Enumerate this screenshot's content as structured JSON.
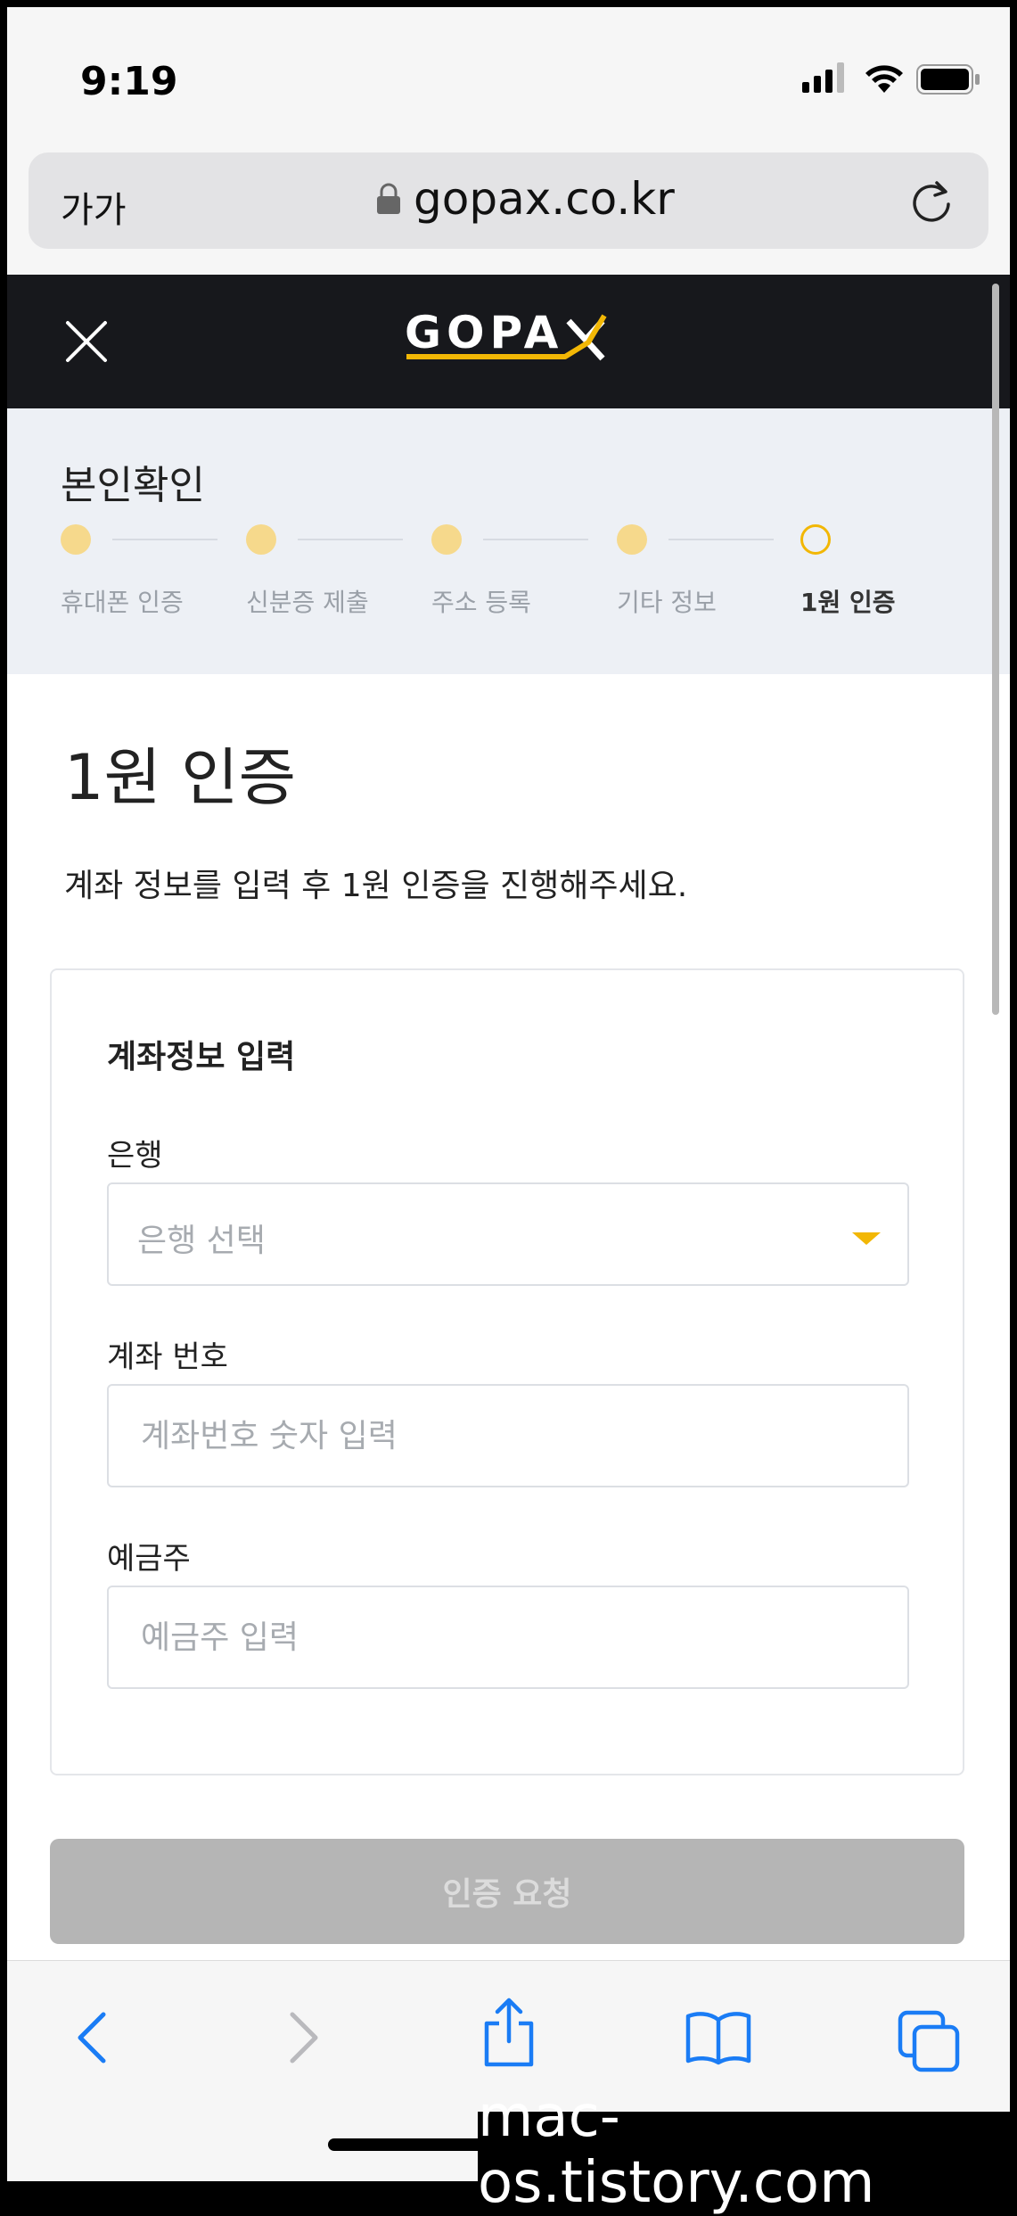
{
  "status": {
    "time": "9:19"
  },
  "browser": {
    "text_size": "가가",
    "url": "gopax.co.kr"
  },
  "site": {
    "logo": "GOPAX"
  },
  "stepper": {
    "title": "본인확인",
    "steps": [
      {
        "label": "휴대폰 인증",
        "state": "done"
      },
      {
        "label": "신분증 제출",
        "state": "done"
      },
      {
        "label": "주소 등록",
        "state": "done"
      },
      {
        "label": "기타 정보",
        "state": "done"
      },
      {
        "label": "1원 인증",
        "state": "current"
      }
    ]
  },
  "main": {
    "title": "1원 인증",
    "description": "계좌 정보를 입력 후 1원 인증을 진행해주세요.",
    "card_title": "계좌정보 입력",
    "bank": {
      "label": "은행",
      "placeholder": "은행 선택"
    },
    "account": {
      "label": "계좌 번호",
      "placeholder": "계좌번호 숫자 입력"
    },
    "holder": {
      "label": "예금주",
      "placeholder": "예금주 입력"
    },
    "submit_label": "인증 요청"
  },
  "watermark": "mac-os.tistory.com",
  "colors": {
    "accent": "#f2b705",
    "step_done": "#f6d98c",
    "header_bg": "#17181c",
    "button_disabled": "#b5b5b5",
    "ios_blue": "#1a7cf5"
  }
}
